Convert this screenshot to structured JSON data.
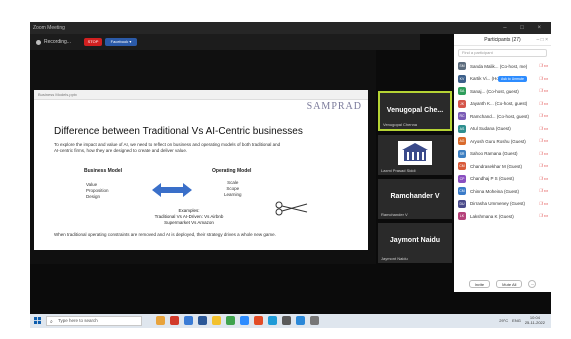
{
  "window": {
    "title": "Zoom Meeting",
    "controls": "– □ ×"
  },
  "toolbar": {
    "recording_label": "Recording...",
    "stop_label": "STOP",
    "facebook_label": "Facebook ▾"
  },
  "slide": {
    "file_label": "Business Models.pptx",
    "brand": "SAMPRAD",
    "title": "Difference between Traditional Vs AI-Centric businesses",
    "description": "To explore the impact and value of AI, we need to reflect on business and operating models of both traditional and AI-centric firms, how they are designed to create and deliver value.",
    "business_model": {
      "heading": "Business Model",
      "items": [
        "Value",
        "Proposition",
        "Design"
      ]
    },
    "operating_model": {
      "heading": "Operating Model",
      "items": [
        "Scale",
        "Scope",
        "Learning"
      ]
    },
    "example": {
      "heading": "Examples:",
      "line1": "Traditional Vs AI-Driven: Vs Airbnb",
      "line2": "Supermarket Vs Amazon"
    },
    "footer": "When traditional operating constraints are removed and AI is deployed, their strategy drives a whole new game."
  },
  "video_tiles": [
    {
      "name": "Venugopal Che...",
      "sub": "Venugopal Chenna",
      "active": true
    },
    {
      "name": "",
      "sub": "Laxmi Prasad Siddi",
      "logo": true
    },
    {
      "name": "Ramchander V",
      "sub": "Ramchander V"
    },
    {
      "name": "Jaymont Naidu",
      "sub": "Jaymont Naidu"
    }
  ],
  "participants": {
    "header": "Participants (27)",
    "search_placeholder": "Find a participant",
    "admit_label": "Ask to Unmute",
    "list": [
      {
        "name": "Sanda Malik... (Co-host, me)",
        "initials": "SM",
        "color": "#5b6b7c"
      },
      {
        "name": "Kartik Vi... (Host)",
        "initials": "KV",
        "color": "#3c5f8a"
      },
      {
        "name": "Sanaj... (Co-host, guest)",
        "initials": "SA",
        "color": "#2e9e5b"
      },
      {
        "name": "Jayanth K... (Co-host, guest)",
        "initials": "JK",
        "color": "#d5564a"
      },
      {
        "name": "Ramchand... (Co-host, guest)",
        "initials": "RC",
        "color": "#7a5bb5"
      },
      {
        "name": "Atul Sudana (Guest)",
        "initials": "AS",
        "color": "#2e8f8f"
      },
      {
        "name": "Aryosh Guru Roshu (Guest)",
        "initials": "AG",
        "color": "#d96a2b"
      },
      {
        "name": "Sahoo Ramana (Guest)",
        "initials": "SR",
        "color": "#3d7fc2"
      },
      {
        "name": "Chandrasekhar M (Guest)",
        "initials": "CM",
        "color": "#d85a3a"
      },
      {
        "name": "Chandhaj P S (Guest)",
        "initials": "CP",
        "color": "#8a4fc0"
      },
      {
        "name": "Chinna Moheina (Guest)",
        "initials": "CM",
        "color": "#3a7bc8"
      },
      {
        "name": "Dirrasha Ummeney (Guest)",
        "initials": "DU",
        "color": "#4a4a8a"
      },
      {
        "name": "Lakshmana K (Guest)",
        "initials": "LK",
        "color": "#b5427a"
      }
    ],
    "invite_label": "Invite",
    "mute_all_label": "Mute All",
    "more_label": "..."
  },
  "taskbar": {
    "search_placeholder": "Type here to search",
    "search_icon": "search-icon",
    "temperature": "29°C",
    "language": "ENG",
    "time": "10:04",
    "date": "25-11-2022",
    "app_colors": [
      "#e8a33c",
      "#d23a2a",
      "#3a7bd5",
      "#2b5797",
      "#f2c12e",
      "#3fa34d",
      "#2d8cff",
      "#e34c26",
      "#1f9bd7",
      "#5a5a5a",
      "#2b88d8",
      "#777777"
    ]
  },
  "colors": {
    "active_speaker": "#b5d334",
    "record_stop": "#d12020",
    "zoom_blue": "#2d8cff",
    "muted_red": "#d33333"
  }
}
